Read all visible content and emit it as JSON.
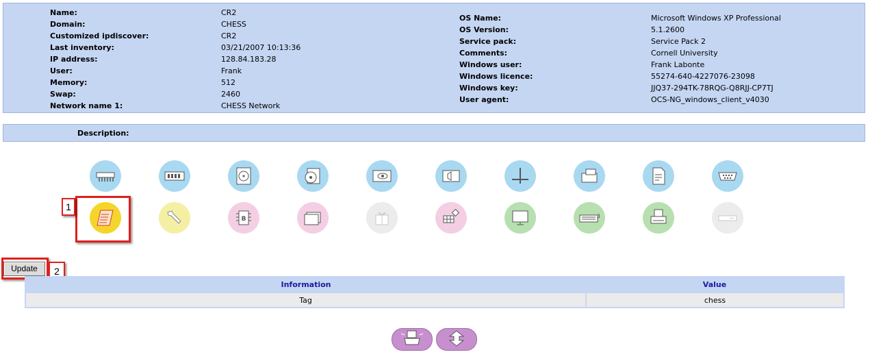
{
  "left_fields": [
    {
      "label": "Name:",
      "value": "CR2"
    },
    {
      "label": "Domain:",
      "value": "CHESS"
    },
    {
      "label": "Customized ipdiscover:",
      "value": "CR2"
    },
    {
      "label": "Last inventory:",
      "value": "03/21/2007 10:13:36"
    },
    {
      "label": "IP address:",
      "value": "128.84.183.28"
    },
    {
      "label": "User:",
      "value": "Frank"
    },
    {
      "label": "Memory:",
      "value": "512"
    },
    {
      "label": "Swap:",
      "value": "2460"
    },
    {
      "label": "Network name 1:",
      "value": "CHESS Network"
    }
  ],
  "right_fields": [
    {
      "label": "OS Name:",
      "value": "Microsoft Windows XP Professional"
    },
    {
      "label": "OS Version:",
      "value": "5.1.2600"
    },
    {
      "label": "Service pack:",
      "value": "Service Pack 2"
    },
    {
      "label": "Comments:",
      "value": "Cornell University"
    },
    {
      "label": "Windows user:",
      "value": "Frank Labonte"
    },
    {
      "label": "Windows licence:",
      "value": "55274-640-4227076-23098"
    },
    {
      "label": "Windows key:",
      "value": "JJQ37-294TK-78RQG-Q8RJJ-CP7TJ"
    },
    {
      "label": "User agent:",
      "value": "OCS-NG_windows_client_v4030"
    }
  ],
  "description_label": "Description:",
  "icons_row1": [
    "memory-slots-icon",
    "ram-icon",
    "hard-drive-icon",
    "storage-icon",
    "video-card-icon",
    "sound-icon",
    "network-icon",
    "drives-icon",
    "software-icon",
    "ports-icon"
  ],
  "icons_row2": [
    "registry-icon",
    "admin-wrench-icon",
    "bios-icon",
    "folders-icon",
    "gift-icon",
    "grid-icon",
    "monitor-icon",
    "keyboard-icon",
    "printer-icon",
    "modem-icon"
  ],
  "callouts": {
    "one": "1",
    "two": "2"
  },
  "update_label": "Update",
  "table": {
    "headers": [
      "Information",
      "Value"
    ],
    "rows": [
      [
        "Tag",
        "chess"
      ]
    ]
  },
  "nav": [
    "print-icon",
    "expand-icon"
  ]
}
